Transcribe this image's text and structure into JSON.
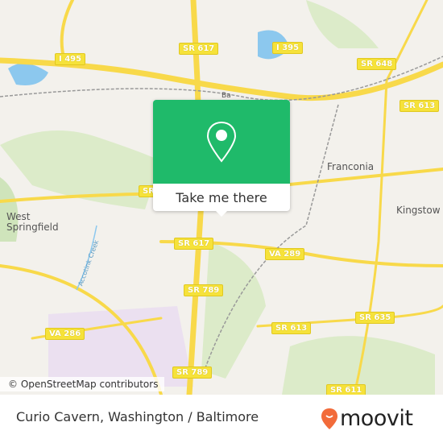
{
  "map": {
    "shields": [
      "I 495",
      "SR 617",
      "I 395",
      "SR 648",
      "SR 613",
      "SR",
      "SR 617",
      "VA 289",
      "SR 789",
      "SR 613",
      "SR 635",
      "VA 286",
      "SR 789",
      "SR 611"
    ],
    "places": [
      "Franconia",
      "Kingstow",
      "West\nSpringfield",
      "Accotink Creek",
      "Ba"
    ],
    "attribution": "© OpenStreetMap contributors"
  },
  "popup": {
    "button_label": "Take me there",
    "color": "#1fba6a"
  },
  "footer": {
    "title": "Curio Cavern, Washington / Baltimore",
    "brand": "moovit",
    "brand_color": "#f26b3a"
  }
}
